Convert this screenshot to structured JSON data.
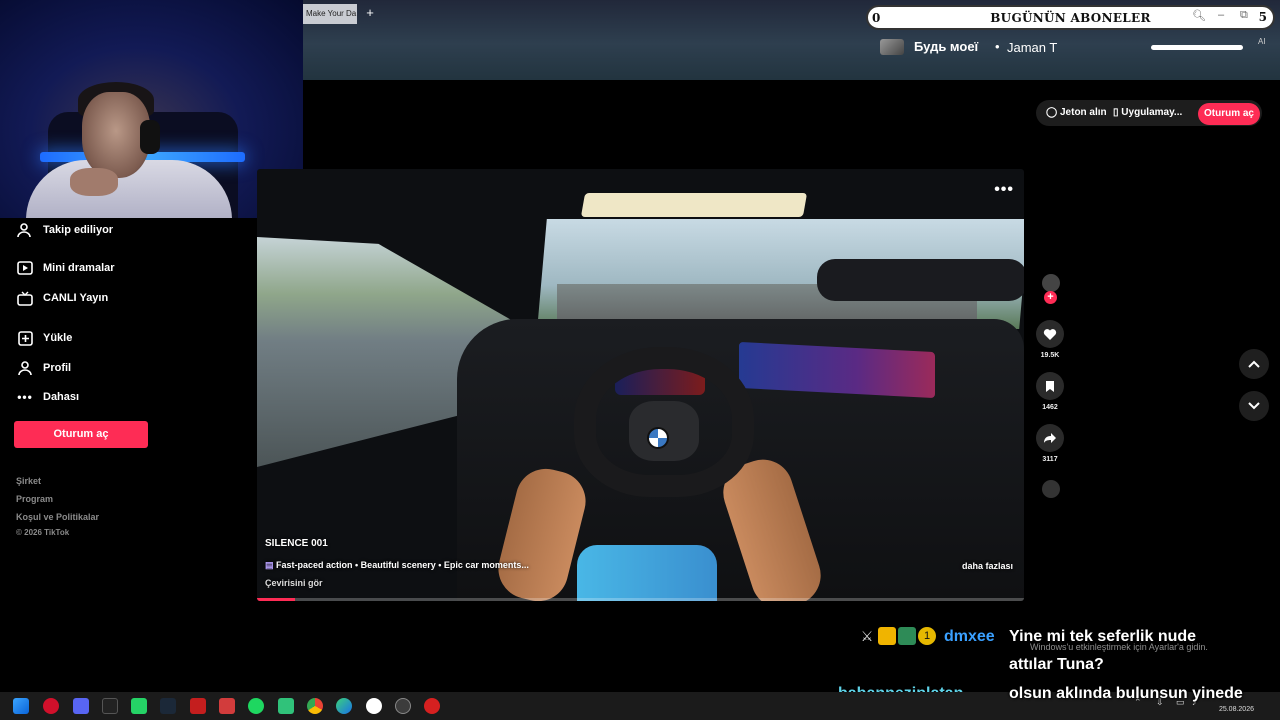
{
  "browser": {
    "tab_label": "Make Your Da",
    "new_tab_glyph": "+"
  },
  "subscriber_widget": {
    "count": "0",
    "title": "BUGÜNÜN ABONELER",
    "right_value": "5"
  },
  "now_playing": {
    "title": "Будь моеї",
    "separator": "•",
    "artist": "Jaman T",
    "ai_tag": "AI"
  },
  "header": {
    "coins_label": "Jeton alın",
    "app_label": "Uygulamay...",
    "login_label": "Oturum aç"
  },
  "sidebar": {
    "items": [
      {
        "label": "Takip ediliyor",
        "icon": "person-follow-icon"
      },
      {
        "label": "Mini dramalar",
        "icon": "mini-drama-icon"
      },
      {
        "label": "CANLI Yayın",
        "icon": "live-tv-icon"
      },
      {
        "label": "Yükle",
        "icon": "upload-plus-icon"
      },
      {
        "label": "Profil",
        "icon": "profile-icon"
      },
      {
        "label": "Dahası",
        "icon": "more-dots-icon"
      }
    ],
    "login_label": "Oturum aç",
    "footer": [
      "Şirket",
      "Program",
      "Koşul ve Politikalar",
      "© 2026 TikTok"
    ]
  },
  "video": {
    "title": "SILENCE 001",
    "description": "Fast-paced action • Beautiful scenery • Epic car moments...",
    "translate_label": "Çevirisini gör",
    "more_label": "daha fazlası",
    "options_glyph": "•••",
    "progress": 0.05
  },
  "actions": {
    "likes": "19.5K",
    "saves": "1462",
    "shares": "3117"
  },
  "chat": {
    "user1": "dmxee",
    "message1_line1": "Yine mi tek seferlik nude",
    "message1_line2": "attılar Tuna?",
    "user2": "babanneziplatan...",
    "message2": "olsun aklında bulunsun yinede",
    "badge_number": "1"
  },
  "windows_watermark": "Windows'u etkinleştirmek için Ayarlar'a gidin.",
  "taskbar": {
    "date": "25.08.2026"
  },
  "colors": {
    "tiktok_pink": "#fe2c55",
    "chat_user_blue": "#3aa0ff",
    "chat_user_teal": "#5fd3e8"
  }
}
